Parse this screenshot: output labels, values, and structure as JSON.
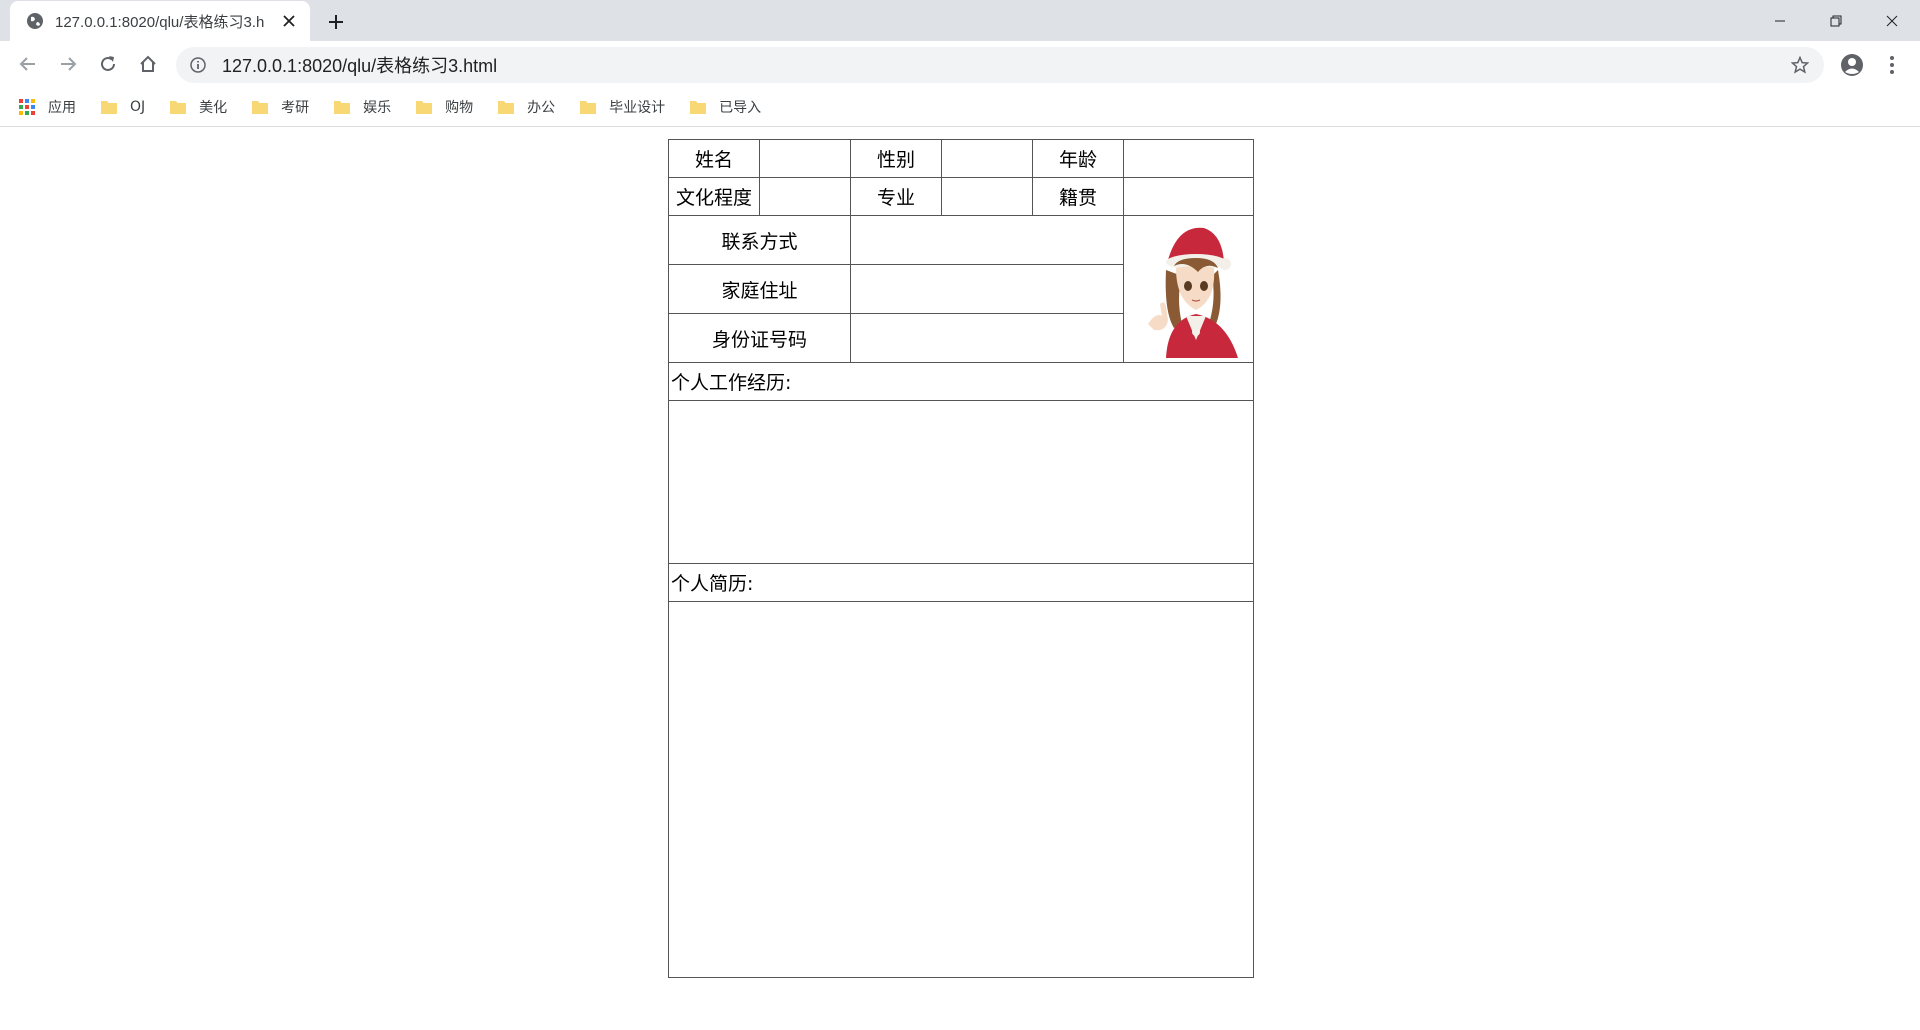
{
  "tab": {
    "title": "127.0.0.1:8020/qlu/表格练习3.h"
  },
  "address_bar": {
    "url": "127.0.0.1:8020/qlu/表格练习3.html"
  },
  "bookmarks": [
    {
      "label": "应用",
      "icon": "apps-grid-icon"
    },
    {
      "label": "OJ",
      "icon": "folder-icon"
    },
    {
      "label": "美化",
      "icon": "folder-icon"
    },
    {
      "label": "考研",
      "icon": "folder-icon"
    },
    {
      "label": "娱乐",
      "icon": "folder-icon"
    },
    {
      "label": "购物",
      "icon": "folder-icon"
    },
    {
      "label": "办公",
      "icon": "folder-icon"
    },
    {
      "label": "毕业设计",
      "icon": "folder-icon"
    },
    {
      "label": "已导入",
      "icon": "folder-icon"
    }
  ],
  "resume": {
    "row1": {
      "name": "姓名",
      "gender": "性别",
      "age": "年龄"
    },
    "row2": {
      "education": "文化程度",
      "major": "专业",
      "hometown": "籍贯"
    },
    "contact": "联系方式",
    "address": "家庭住址",
    "id_number": "身份证号码",
    "work_history": "个人工作经历:",
    "bio": "个人简历:"
  },
  "colors": {
    "tabstrip": "#dee1e6",
    "omnibox": "#f1f3f4",
    "folder": "#f8d775",
    "border": "#555555"
  }
}
